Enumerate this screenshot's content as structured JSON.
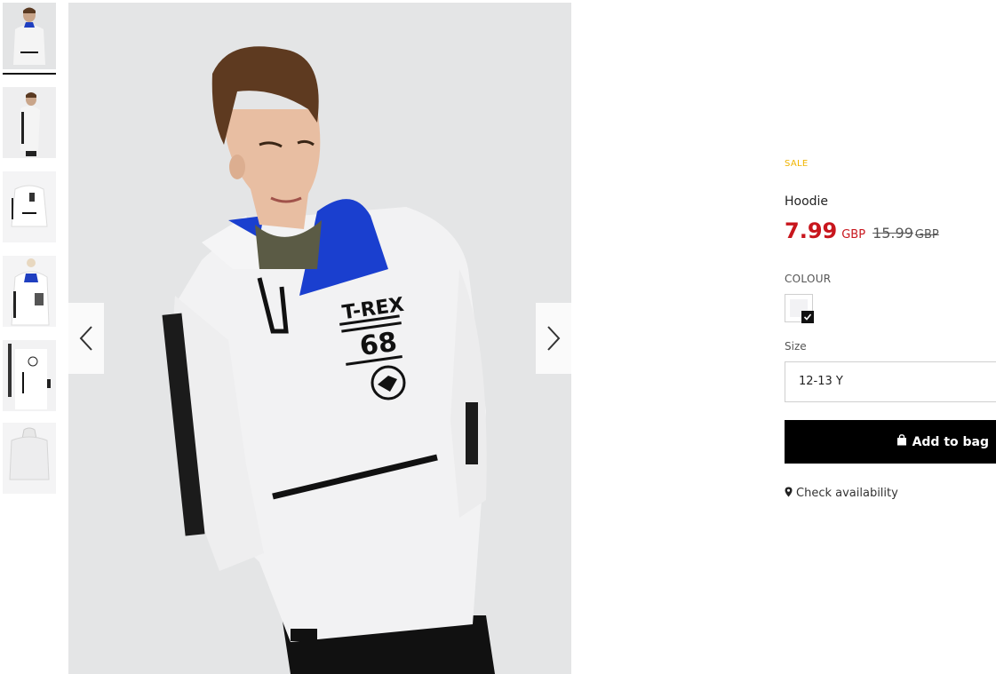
{
  "thumbnails": [
    {
      "icon": "hoodie-front-model-thumb",
      "selected": true
    },
    {
      "icon": "hoodie-side-model-thumb",
      "selected": false
    },
    {
      "icon": "hoodie-flat-front-thumb",
      "selected": false
    },
    {
      "icon": "hoodie-hanger-thumb",
      "selected": false
    },
    {
      "icon": "hoodie-sleeve-detail-thumb",
      "selected": false
    },
    {
      "icon": "hoodie-back-thumb",
      "selected": false
    }
  ],
  "gallery": {
    "prev_icon": "chevron-left-icon",
    "next_icon": "chevron-right-icon",
    "print": {
      "line1": "T-REX",
      "line2": "68"
    }
  },
  "product": {
    "badge": "SALE",
    "name": "Hoodie",
    "price": "7.99",
    "currency": "GBP",
    "old_price": "15.99",
    "old_currency": "GBP",
    "colour_label": "COLOUR",
    "colour_selected": "light grey",
    "size_label": "Size",
    "size_value": "12-13 Y",
    "add_to_bag": "Add to bag",
    "check_availability": "Check availability"
  },
  "colors": {
    "sale": "#f0b400",
    "price": "#c8161d",
    "button_bg": "#000000",
    "background": "#ffffff"
  }
}
